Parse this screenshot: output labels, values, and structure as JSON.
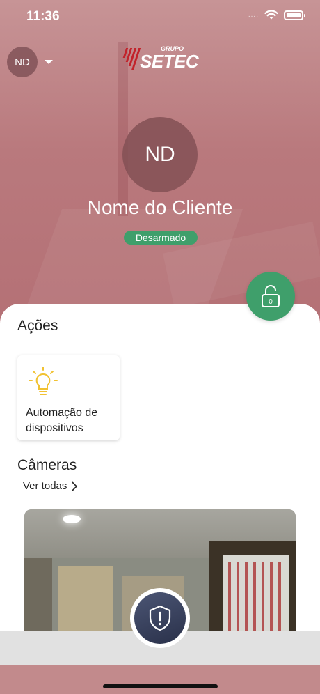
{
  "status_bar": {
    "time": "11:36",
    "signal": "....",
    "icons": [
      "wifi-icon",
      "battery-icon"
    ]
  },
  "header": {
    "user_initials": "ND",
    "logo": {
      "small": "GRUPO",
      "large": "SETEC"
    }
  },
  "profile": {
    "initials": "ND",
    "name": "Nome do Cliente",
    "status": "Desarmado",
    "lock_counter": "0"
  },
  "actions": {
    "title": "Ações",
    "items": [
      {
        "label": "Automação de dispositivos",
        "icon": "lightbulb-icon"
      }
    ]
  },
  "cameras": {
    "title": "Câmeras",
    "see_all": "Ver todas"
  },
  "colors": {
    "hero": "#c28a8c",
    "accent_green": "#3f9f6b",
    "fab_dark": "#2f3650",
    "bulb_yellow": "#f1c232"
  }
}
